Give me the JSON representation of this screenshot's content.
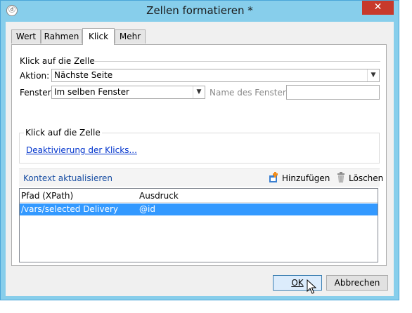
{
  "window": {
    "title": "Zellen formatieren *",
    "app_icon": "dialog-app-icon",
    "close_label": "✕"
  },
  "tabs": [
    {
      "label": "Wert",
      "active": false
    },
    {
      "label": "Rahmen",
      "active": false
    },
    {
      "label": "Klick",
      "active": true
    },
    {
      "label": "Mehr",
      "active": false
    }
  ],
  "click_section": {
    "title": "Klick auf die Zelle",
    "action_label": "Aktion:",
    "action_value": "Nächste Seite",
    "window_label": "Fenster:",
    "window_value": "Im selben Fenster",
    "window_name_label": "Name des Fensters:",
    "window_name_value": ""
  },
  "group": {
    "title": "Klick auf die Zelle",
    "link_label": "Deaktivierung der Klicks..."
  },
  "toolbar": {
    "context_label": "Kontext aktualisieren",
    "add_label": "Hinzufügen",
    "delete_label": "Löschen"
  },
  "grid": {
    "columns": [
      "Pfad (XPath)",
      "Ausdruck"
    ],
    "rows": [
      {
        "path": "/vars/selected Delivery",
        "expression": "@id",
        "selected": true
      }
    ]
  },
  "buttons": {
    "ok_label": "OK",
    "cancel_label": "Abbrechen"
  },
  "colors": {
    "accent": "#3399ff",
    "link": "#0033cc",
    "close": "#c7392b",
    "frame": "#87ceeb"
  }
}
